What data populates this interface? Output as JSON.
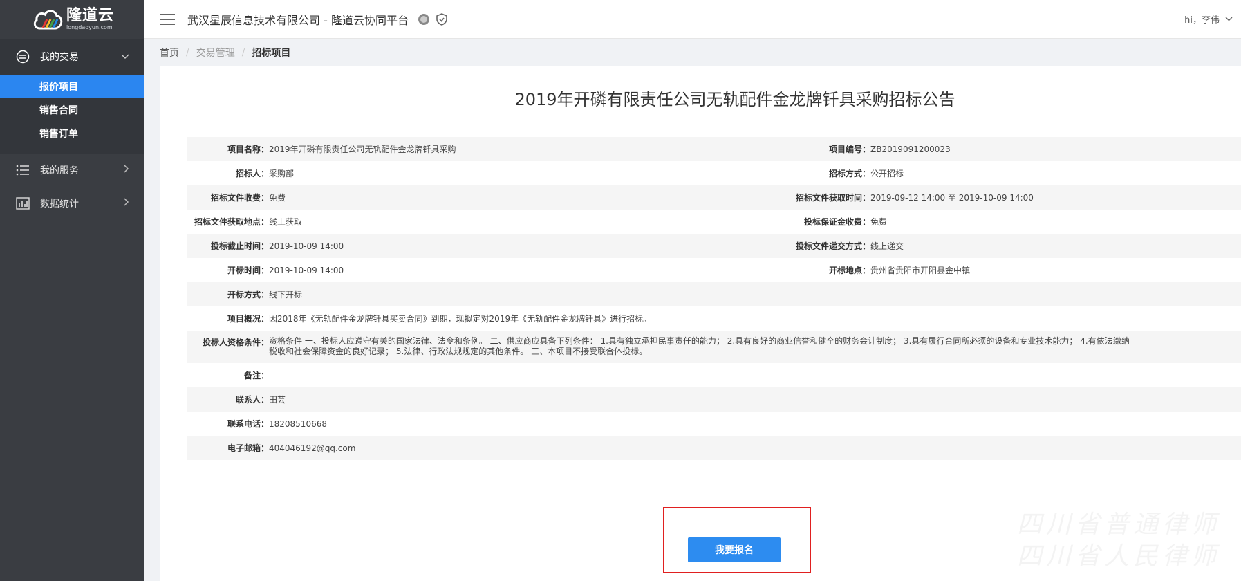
{
  "brand": {
    "name": "隆道云",
    "domain": "longdaoyun.com"
  },
  "header": {
    "company": "武汉星辰信息技术有限公司 - 隆道云协同平台",
    "user_greeting": "hi，李伟"
  },
  "sidebar": {
    "groups": [
      {
        "label": "我的交易",
        "icon": "exchange-icon",
        "expanded": true,
        "items": [
          {
            "label": "报价项目",
            "active": true
          },
          {
            "label": "销售合同",
            "active": false
          },
          {
            "label": "销售订单",
            "active": false
          }
        ]
      }
    ],
    "plain": [
      {
        "label": "我的服务",
        "icon": "list-icon"
      },
      {
        "label": "数据统计",
        "icon": "chart-icon"
      }
    ]
  },
  "breadcrumb": [
    "首页",
    "交易管理",
    "招标项目"
  ],
  "notice": {
    "title": "2019年开磷有限责任公司无轨配件金龙牌钎具采购招标公告",
    "fields": {
      "project_name_label": "项目名称：",
      "project_name": "2019年开磷有限责任公司无轨配件金龙牌钎具采购",
      "project_no_label": "项目编号：",
      "project_no": "ZB2019091200023",
      "tenderer_label": "招标人：",
      "tenderer": "采购部",
      "method_label": "招标方式：",
      "method": "公开招标",
      "doc_fee_label": "招标文件收费：",
      "doc_fee": "免费",
      "doc_time_label": "招标文件获取时间：",
      "doc_time": "2019-09-12 14:00 至 2019-10-09 14:00",
      "doc_place_label": "招标文件获取地点：",
      "doc_place": "线上获取",
      "deposit_label": "投标保证金收费：",
      "deposit": "免费",
      "deadline_label": "投标截止时间：",
      "deadline": "2019-10-09 14:00",
      "submit_label": "投标文件递交方式：",
      "submit": "线上递交",
      "open_time_label": "开标时间：",
      "open_time": "2019-10-09 14:00",
      "open_place_label": "开标地点：",
      "open_place": "贵州省贵阳市开阳县金中镇",
      "open_method_label": "开标方式：",
      "open_method": "线下开标",
      "overview_label": "项目概况：",
      "overview": "因2018年《无轨配件金龙牌钎具买卖合同》到期，现拟定对2019年《无轨配件金龙牌钎具》进行招标。",
      "qualification_label": "投标人资格条件：",
      "qualification": "资格条件 一、投标人应遵守有关的国家法律、法令和条例。 二、供应商应具备下列条件： 1.具有独立承担民事责任的能力； 2.具有良好的商业信誉和健全的财务会计制度； 3.具有履行合同所必须的设备和专业技术能力； 4.有依法缴纳税收和社会保障资金的良好记录； 5.法律、行政法规规定的其他条件。 三、本项目不接受联合体投标。",
      "remark_label": "备注：",
      "remark": "",
      "contact_label": "联系人：",
      "contact": "田芸",
      "phone_label": "联系电话：",
      "phone": "18208510668",
      "email_label": "电子邮箱：",
      "email": "404046192@qq.com"
    },
    "apply_button": "我要报名"
  },
  "colors": {
    "sidebar_bg": "#3a3d42",
    "active": "#2b86f0",
    "button": "#2d8cf0",
    "highlight": "#e02020"
  }
}
